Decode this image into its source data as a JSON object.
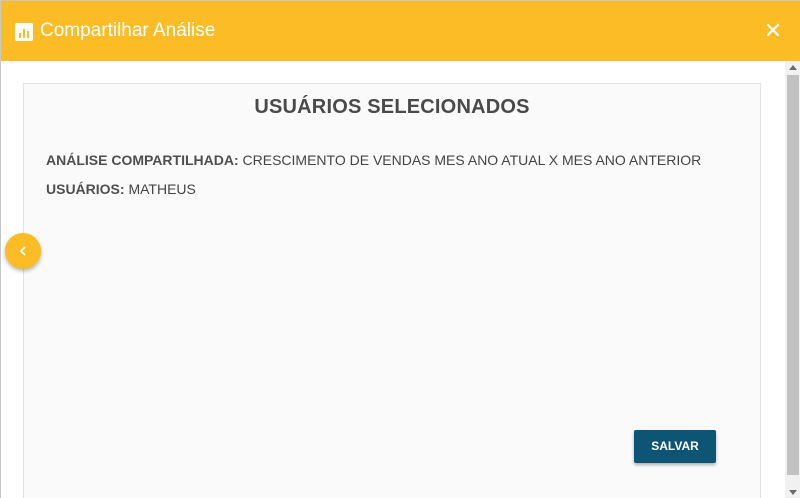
{
  "header": {
    "title": "Compartilhar Análise",
    "icon": "bar-chart-icon",
    "close_symbol": "✕"
  },
  "card": {
    "title": "USUÁRIOS SELECIONADOS",
    "analysis_label": "ANÁLISE COMPARTILHADA:",
    "analysis_value": " CRESCIMENTO DE VENDAS MES ANO ATUAL X MES ANO ANTERIOR",
    "users_label": "USUÁRIOS:",
    "users_value": " MATHEUS",
    "save_label": "SALVAR"
  },
  "colors": {
    "header": "#fbbc25",
    "save_button": "#0e5575",
    "prev_button": "#fbbc25"
  }
}
